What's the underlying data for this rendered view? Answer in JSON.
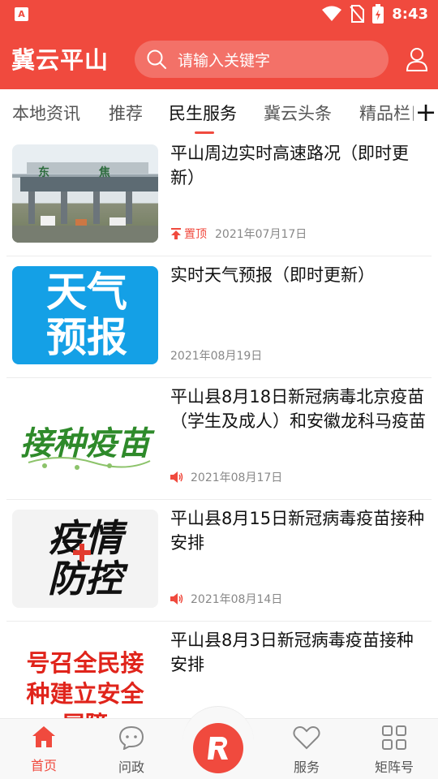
{
  "status": {
    "time": "8:43",
    "app_badge": "A"
  },
  "header": {
    "title": "冀云平山",
    "search_placeholder": "请输入关键字"
  },
  "tabs": [
    {
      "label": "本地资讯"
    },
    {
      "label": "推荐"
    },
    {
      "label": "民生服务",
      "active": true
    },
    {
      "label": "冀云头条"
    },
    {
      "label": "精品栏目"
    }
  ],
  "tab_more": "+",
  "news": [
    {
      "title": "平山周边实时高速路况（即时更新）",
      "pinned": "置顶",
      "date": "2021年07月17日",
      "thumb_text": "东 焦"
    },
    {
      "title": "实时天气预报（即时更新）",
      "date": "2021年08月19日",
      "thumb_text": "天气预报"
    },
    {
      "title": "平山县8月18日新冠病毒北京疫苗（学生及成人）和安徽龙科马疫苗",
      "date": "2021年08月17日",
      "thumb_text": "接种疫苗"
    },
    {
      "title": "平山县8月15日新冠病毒疫苗接种安排",
      "date": "2021年08月14日",
      "thumb_text": "疫情防控"
    },
    {
      "title": "平山县8月3日新冠病毒疫苗接种安排",
      "thumb_text": "号召全民接种建立安全屏障"
    }
  ],
  "bottom_nav": [
    {
      "label": "首页",
      "icon": "home-icon",
      "active": true
    },
    {
      "label": "问政",
      "icon": "chat-icon"
    },
    {
      "label": "",
      "icon": "center-logo-icon"
    },
    {
      "label": "服务",
      "icon": "heart-icon"
    },
    {
      "label": "矩阵号",
      "icon": "grid-icon"
    }
  ],
  "colors": {
    "brand": "#f04a3e"
  }
}
